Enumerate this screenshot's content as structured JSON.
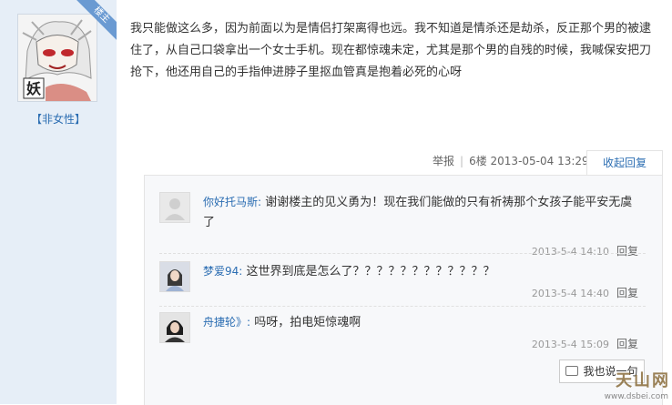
{
  "author": {
    "role_badge": "楼主",
    "name": "【非女性】",
    "avatar_glyph": "妖"
  },
  "post": {
    "text": "我只能做这么多，因为前面以为是情侣打架离得也远。我不知道是情杀还是劫杀，反正那个男的被逮住了，从自己口袋拿出一个女士手机。现在都惊魂未定，尤其是那个男的自残的时候，我喊保安把刀抢下，他还用自己的手指伸进脖子里抠血管真是抱着必死的心呀",
    "report_label": "举报",
    "floor": "6楼",
    "timestamp": "2013-05-04 13:29",
    "collapse_label": "收起回复"
  },
  "replies": [
    {
      "author": "你好托马斯:",
      "text": "谢谢楼主的见义勇为！现在我们能做的只有祈祷那个女孩子能平安无虞了",
      "time": "2013-5-4 14:10",
      "reply_label": "回复"
    },
    {
      "author": "梦爱94:",
      "text": "这世界到底是怎么了？？？？？？？？？？？？",
      "time": "2013-5-4 14:40",
      "reply_label": "回复"
    },
    {
      "author": "舟捷轮》:",
      "text": "吗呀，拍电矩惊魂啊",
      "time": "2013-5-4 15:09",
      "reply_label": "回复"
    }
  ],
  "say_button_label": "我也说一句",
  "watermark": {
    "text": "天山网",
    "url": "www.dsbei.com"
  },
  "colors": {
    "link_blue": "#2b6db2",
    "sidebar_bg": "#e6eef7",
    "badge_blue": "#6a9ad2"
  }
}
